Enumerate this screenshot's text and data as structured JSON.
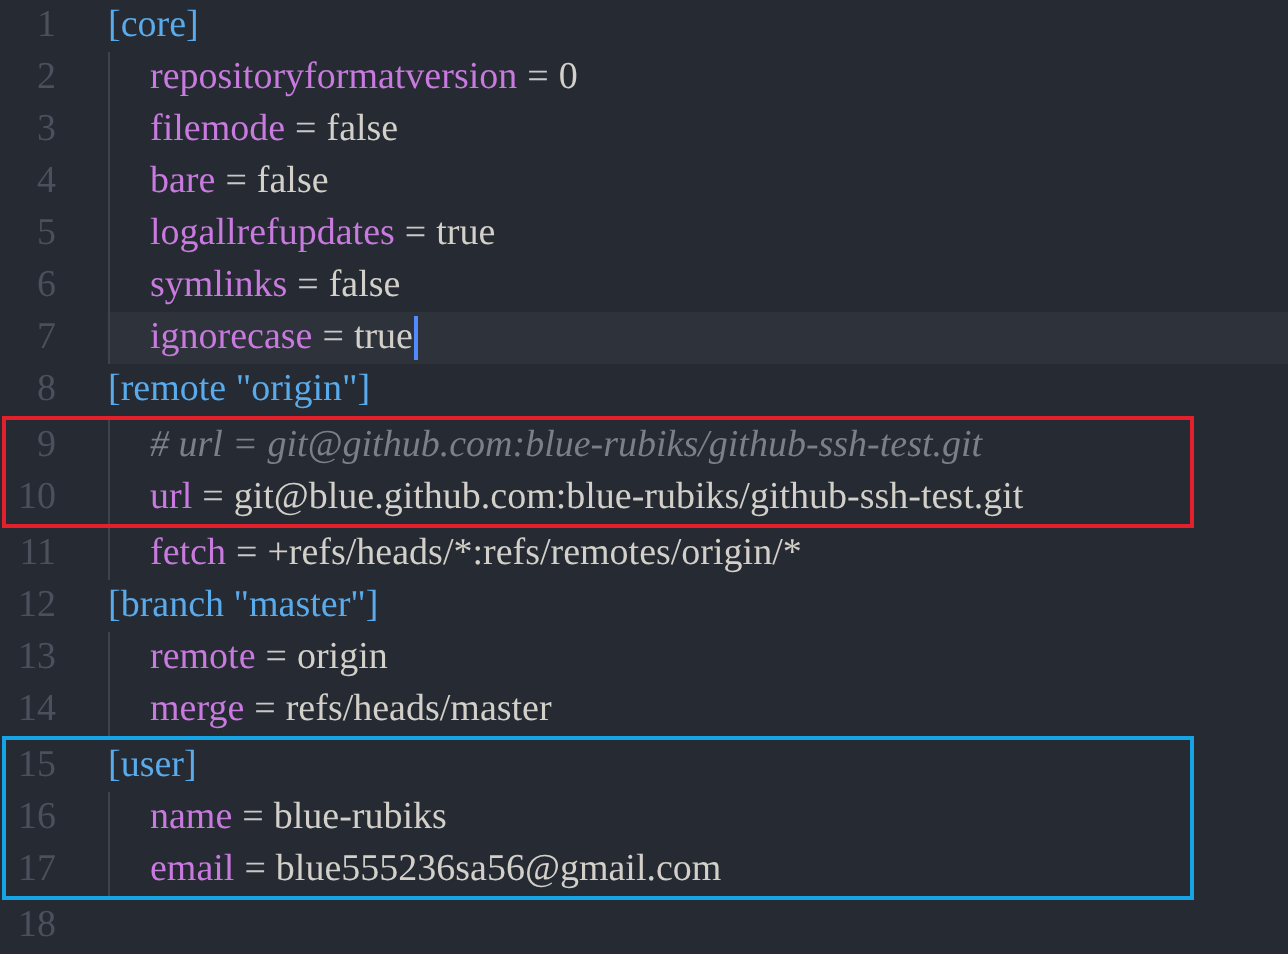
{
  "editor": {
    "blocks": [
      {
        "kind": "plain",
        "lines": [
          {
            "number": "1",
            "kind": "section",
            "text": "[core]",
            "current": false
          },
          {
            "number": "2",
            "kind": "pair",
            "key": "repositoryformatversion",
            "equals": "=",
            "value": "0",
            "current": false
          },
          {
            "number": "3",
            "kind": "pair",
            "key": "filemode",
            "equals": "=",
            "value": "false",
            "current": false
          },
          {
            "number": "4",
            "kind": "pair",
            "key": "bare",
            "equals": "=",
            "value": "false",
            "current": false
          },
          {
            "number": "5",
            "kind": "pair",
            "key": "logallrefupdates",
            "equals": "=",
            "value": "true",
            "current": false
          },
          {
            "number": "6",
            "kind": "pair",
            "key": "symlinks",
            "equals": "=",
            "value": "false",
            "current": false
          },
          {
            "number": "7",
            "kind": "pair",
            "key": "ignorecase",
            "equals": "=",
            "value": "true",
            "current": true
          },
          {
            "number": "8",
            "kind": "section",
            "text": "[remote \"origin\"]",
            "current": false
          }
        ]
      },
      {
        "kind": "boxed",
        "color": "#e3202c",
        "lines": [
          {
            "number": "9",
            "kind": "comment",
            "text": "# url = git@github.com:blue-rubiks/github-ssh-test.git",
            "current": false
          },
          {
            "number": "10",
            "kind": "pair",
            "key": "url",
            "equals": "=",
            "value": "git@blue.github.com:blue-rubiks/github-ssh-test.git",
            "current": false
          }
        ]
      },
      {
        "kind": "plain",
        "lines": [
          {
            "number": "11",
            "kind": "pair",
            "key": "fetch",
            "equals": "=",
            "value": "+refs/heads/*:refs/remotes/origin/*",
            "current": false
          },
          {
            "number": "12",
            "kind": "section",
            "text": "[branch \"master\"]",
            "current": false
          },
          {
            "number": "13",
            "kind": "pair",
            "key": "remote",
            "equals": "=",
            "value": "origin",
            "current": false
          },
          {
            "number": "14",
            "kind": "pair",
            "key": "merge",
            "equals": "=",
            "value": "refs/heads/master",
            "current": false
          }
        ]
      },
      {
        "kind": "boxed",
        "color": "#16a4e4",
        "lines": [
          {
            "number": "15",
            "kind": "section",
            "text": "[user]",
            "current": false
          },
          {
            "number": "16",
            "kind": "pair",
            "key": "name",
            "equals": "=",
            "value": "blue-rubiks",
            "current": false
          },
          {
            "number": "17",
            "kind": "pair",
            "key": "email",
            "equals": "=",
            "value": "blue555236sa56@gmail.com",
            "current": false
          }
        ]
      },
      {
        "kind": "plain",
        "lines": [
          {
            "number": "18",
            "kind": "blank",
            "current": false
          }
        ]
      }
    ]
  }
}
